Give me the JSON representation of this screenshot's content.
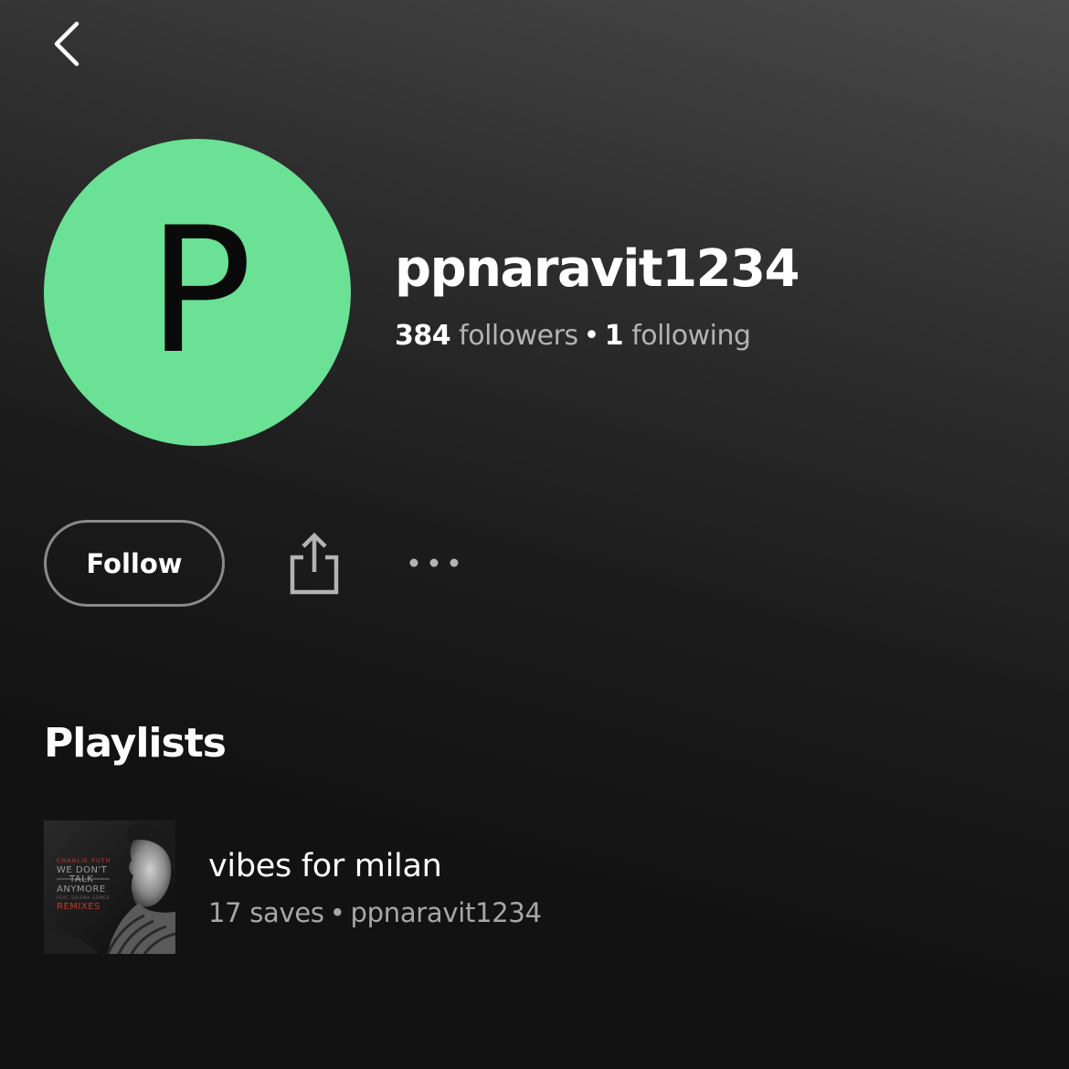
{
  "header": {
    "back_icon": "chevron-left-icon"
  },
  "profile": {
    "avatar_letter": "P",
    "avatar_color": "#6ae194",
    "username": "ppnaravit1234",
    "followers_count": "384",
    "followers_label": "followers",
    "separator": "•",
    "following_count": "1",
    "following_label": "following"
  },
  "actions": {
    "follow_label": "Follow",
    "share_icon": "share-icon",
    "more_icon": "more-horizontal-icon"
  },
  "playlists": {
    "title": "Playlists",
    "items": [
      {
        "name": "vibes for milan",
        "saves": "17 saves",
        "separator": "•",
        "owner": "ppnaravit1234",
        "cover": {
          "artist": "CHARLIE PUTH",
          "line1": "WE DON'T",
          "line2": "TALK",
          "line3": "ANYMORE",
          "feat": "FEAT. SELENA GOMEZ",
          "line4": "REMIXES"
        }
      }
    ]
  },
  "colors": {
    "accent_green": "#6ae194",
    "background": "#121212",
    "secondary_text": "#b3b3b3"
  }
}
